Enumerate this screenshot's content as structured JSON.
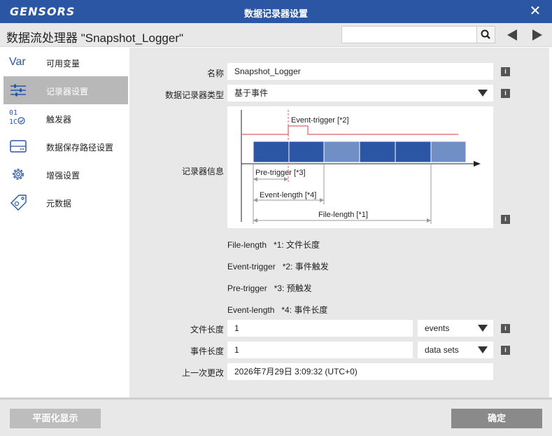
{
  "titlebar": {
    "logo": "GENSORS",
    "title": "数据记录器设置",
    "close_glyph": "✕"
  },
  "header": {
    "title": "数据流处理器 \"Snapshot_Logger\"",
    "search_value": ""
  },
  "sidebar": {
    "items": [
      {
        "label": "可用变量",
        "icon": "var-icon"
      },
      {
        "label": "记录器设置",
        "icon": "sliders-icon"
      },
      {
        "label": "触发器",
        "icon": "binary-check-icon"
      },
      {
        "label": "数据保存路径设置",
        "icon": "storage-icon"
      },
      {
        "label": "增强设置",
        "icon": "gear-icon"
      },
      {
        "label": "元数据",
        "icon": "tag-icon"
      }
    ],
    "var_glyph": "Var",
    "trigger_glyph_top": "01",
    "trigger_glyph_bottom": "1C"
  },
  "form": {
    "name_label": "名称",
    "name_value": "Snapshot_Logger",
    "type_label": "数据记录器类型",
    "type_value": "基于事件",
    "info_label": "记录器信息",
    "info_glyph": "i",
    "file_length_label": "文件长度",
    "file_length_value": "1",
    "file_length_unit": "events",
    "event_length_label": "事件长度",
    "event_length_value": "1",
    "event_length_unit": "data sets",
    "last_changed_label": "上一次更改",
    "last_changed_value": "2026年7月29日   3:09:32 (UTC+0)"
  },
  "diagram": {
    "event_trigger": "Event-trigger [*2]",
    "pre_trigger": "Pre-trigger [*3]",
    "event_length": "Event-length [*4]",
    "file_length": "File-length [*1]",
    "colors": {
      "dark_block": "#2b56a4",
      "light_block": "#6f8fc6",
      "trigger_line": "#e06060"
    }
  },
  "legend": [
    {
      "key": "File-length",
      "desc": "*1: 文件长度"
    },
    {
      "key": "Event-trigger",
      "desc": "*2: 事件触发"
    },
    {
      "key": "Pre-trigger",
      "desc": "*3: 预触发"
    },
    {
      "key": "Event-length",
      "desc": "*4: 事件长度"
    }
  ],
  "footer": {
    "flatten_label": "平面化显示",
    "ok_label": "确定"
  },
  "colors": {
    "brand": "#2b56a4",
    "active_nav": "#b8b8b8"
  }
}
